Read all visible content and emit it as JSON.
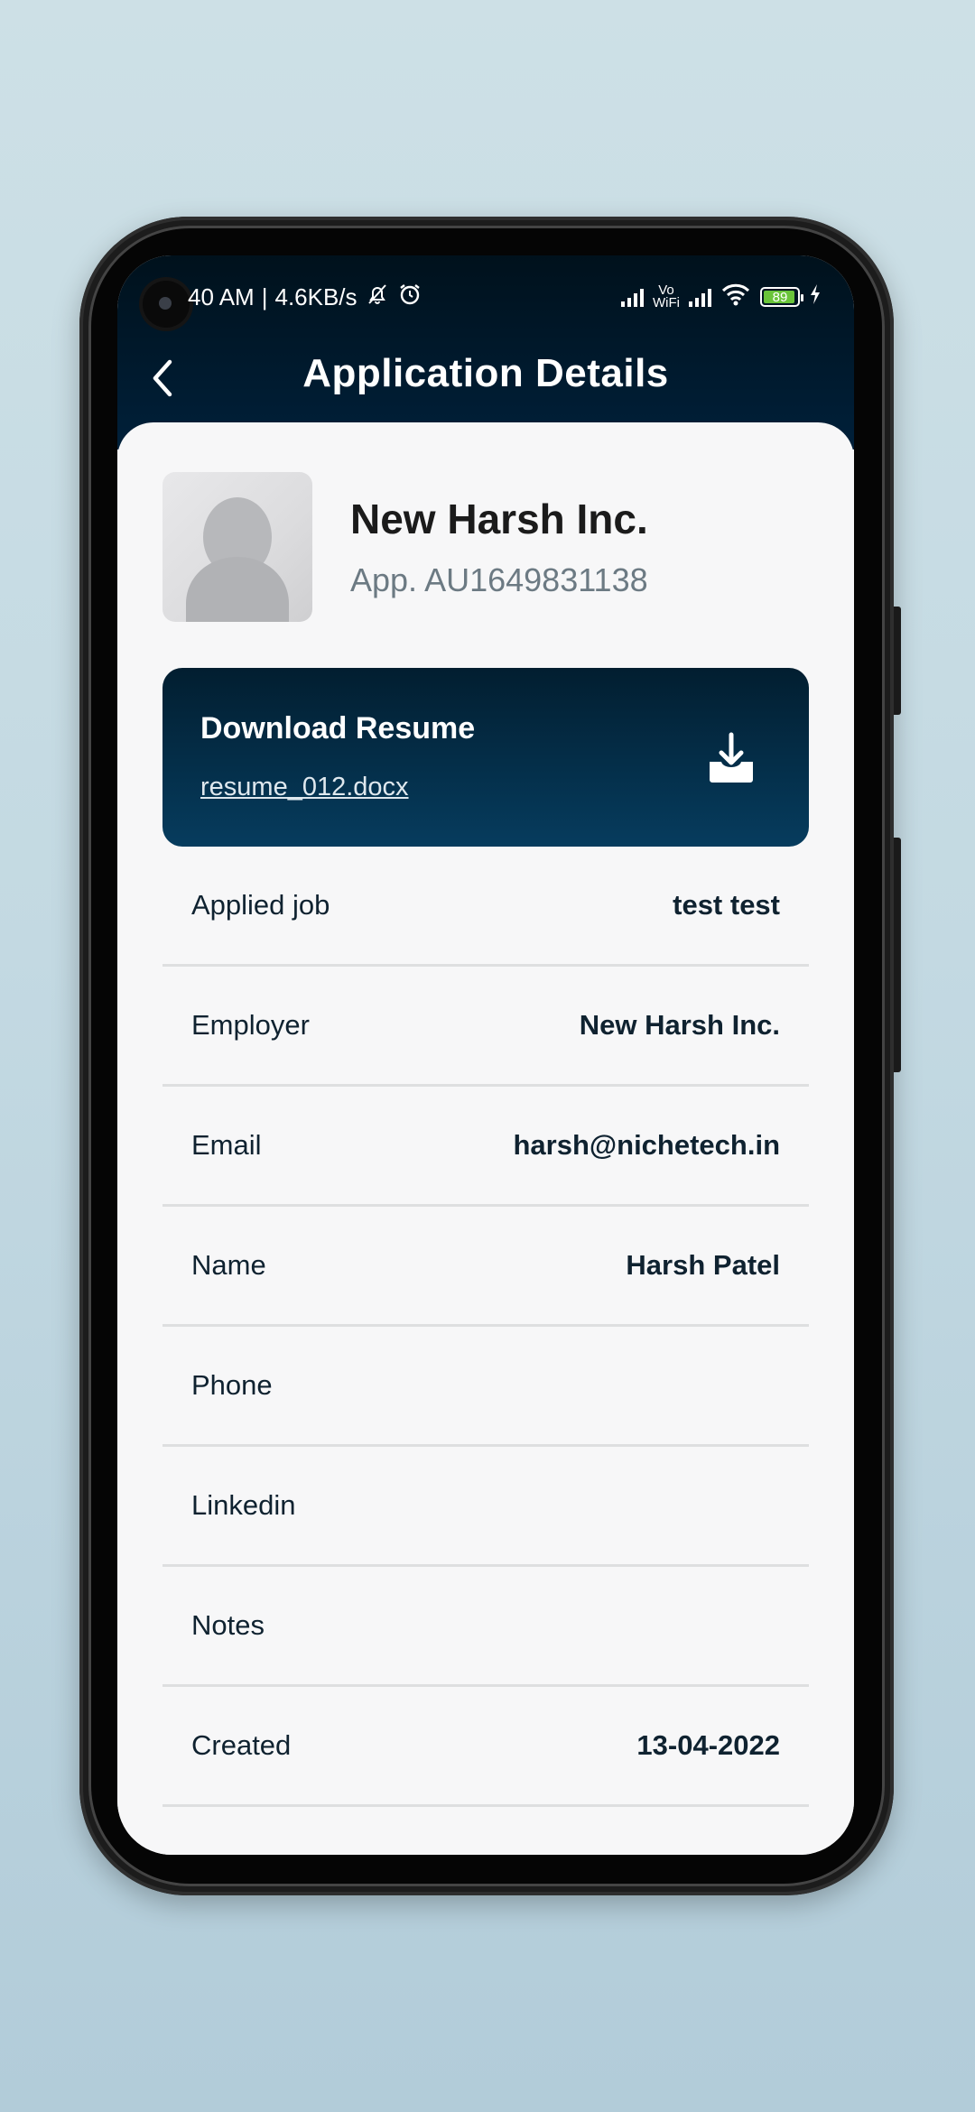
{
  "status_bar": {
    "time": "40 AM",
    "separator": "|",
    "net_speed": "4.6KB/s",
    "icons": [
      "bell-off-icon",
      "alarm-icon",
      "signal-icon",
      "vowifi-icon",
      "signal-icon",
      "wifi-icon",
      "battery-icon",
      "charging-icon"
    ],
    "vowifi_top": "Vo",
    "vowifi_bottom": "WiFi",
    "battery_level": "89",
    "battery_color": "#6ac43a"
  },
  "header": {
    "title": "Application Details",
    "back_icon": "chevron-left-icon",
    "background": "#00192b"
  },
  "profile": {
    "company": "New Harsh Inc.",
    "app_id": "App. AU1649831138",
    "avatar_icon": "person-placeholder-icon"
  },
  "resume": {
    "title": "Download Resume",
    "file_name": "resume_012.docx",
    "icon": "download-icon"
  },
  "details": [
    {
      "label": "Applied job",
      "value": "test test"
    },
    {
      "label": "Employer",
      "value": "New Harsh Inc."
    },
    {
      "label": "Email",
      "value": "harsh@nichetech.in"
    },
    {
      "label": "Name",
      "value": "Harsh Patel"
    },
    {
      "label": "Phone",
      "value": ""
    },
    {
      "label": "Linkedin",
      "value": ""
    },
    {
      "label": "Notes",
      "value": ""
    },
    {
      "label": "Created",
      "value": "13-04-2022"
    }
  ]
}
